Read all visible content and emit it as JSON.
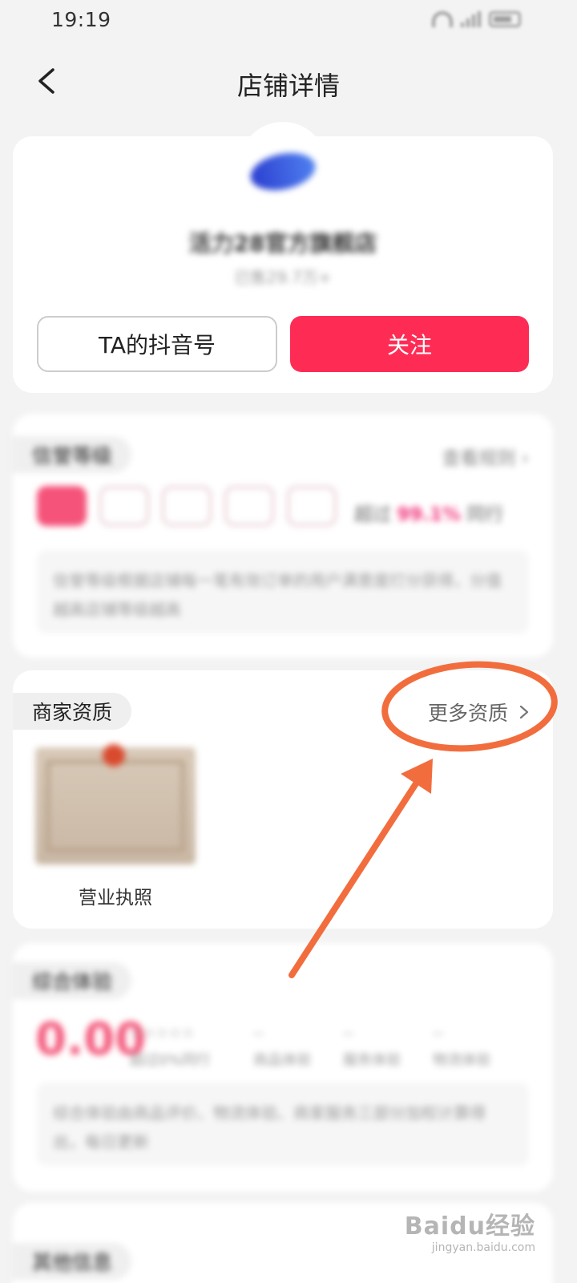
{
  "status_bar": {
    "time": "19:19"
  },
  "nav": {
    "title": "店铺详情"
  },
  "store": {
    "name": "活力28官方旗舰店",
    "sold": "已售29.7万+",
    "douyin_button": "TA的抖音号",
    "follow_button": "关注"
  },
  "credit": {
    "title": "信誉等级",
    "rule_link": "查看规则",
    "exceed_prefix": "超过",
    "exceed_pct": "99.1%",
    "exceed_suffix": "同行",
    "description": "信誉等级根据店铺每一笔有效订单的用户满意度打分获得，分值越高店铺等级越高",
    "badge_level": 1,
    "badge_total": 5
  },
  "merchant": {
    "title": "商家资质",
    "more_link": "更多资质",
    "license_label": "营业执照"
  },
  "experience": {
    "title": "综合体验",
    "score": "0.00",
    "columns": [
      {
        "value": "☆☆☆☆☆",
        "label": "超过0%同行"
      },
      {
        "value": "--",
        "label": "商品体验"
      },
      {
        "value": "--",
        "label": "服务体验"
      },
      {
        "value": "--",
        "label": "物流体验"
      }
    ],
    "description": "综合体验由商品评价、物流体验、商家服务三部分加权计算得出，每日更新"
  },
  "other": {
    "title": "其他信息"
  },
  "watermark": {
    "logo": "Baidu经验",
    "url": "jingyan.baidu.com"
  },
  "colors": {
    "follow": "#fe2c55",
    "annotation": "#f26d3d",
    "accent_pink": "#f0347a"
  }
}
